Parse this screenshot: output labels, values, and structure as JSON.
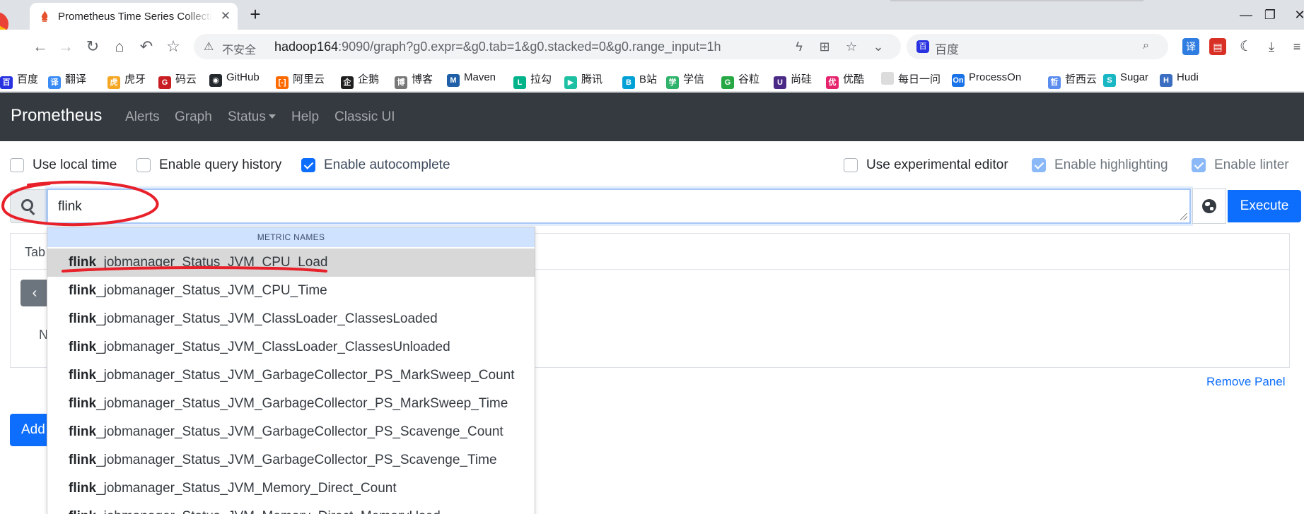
{
  "browser": {
    "tab_title": "Prometheus Time Series Collection and Processing Server",
    "tab_close": "✕",
    "new_tab": "+",
    "window_controls": {
      "minimize": "—",
      "restore": "❐",
      "close": "✕"
    },
    "security_label": "不安全",
    "url_host": "hadoop164",
    "url_rest": ":9090/graph?g0.expr=&g0.tab=1&g0.stacked=0&g0.range_input=1h",
    "search_placeholder": "百度",
    "icons": [
      "back-icon",
      "forward-icon",
      "reload-icon",
      "home-icon",
      "undo-icon",
      "favorite-icon",
      "lightning-icon",
      "translate-icon",
      "star-icon",
      "chevron-down-icon",
      "search-icon",
      "translate-ext-icon",
      "pdf-ext-icon",
      "dark-mode-icon",
      "download-icon",
      "menu-icon"
    ]
  },
  "bookmarks": [
    {
      "label": "百度",
      "icon_color": "#2932e1",
      "glyph": "百"
    },
    {
      "label": "翻译",
      "icon_color": "#3b8cf7",
      "glyph": "译"
    },
    {
      "label": "虎牙",
      "icon_color": "#f5a623",
      "glyph": "虎"
    },
    {
      "label": "码云",
      "icon_color": "#c71d23",
      "glyph": "G"
    },
    {
      "label": "GitHub",
      "icon_color": "#24292e",
      "glyph": "◉"
    },
    {
      "label": "阿里云",
      "icon_color": "#ff6a00",
      "glyph": "[-]"
    },
    {
      "label": "企鹅",
      "icon_color": "#1f1f1f",
      "glyph": "企"
    },
    {
      "label": "博客",
      "icon_color": "#777777",
      "glyph": "博"
    },
    {
      "label": "Maven",
      "icon_color": "#1f5fa8",
      "glyph": "M"
    },
    {
      "label": "拉勾",
      "icon_color": "#00b38a",
      "glyph": "L"
    },
    {
      "label": "腾讯",
      "icon_color": "#1dc0a3",
      "glyph": "▶"
    },
    {
      "label": "B站",
      "icon_color": "#00a1d6",
      "glyph": "B"
    },
    {
      "label": "学信",
      "icon_color": "#2fb36b",
      "glyph": "学"
    },
    {
      "label": "谷粒",
      "icon_color": "#27a844",
      "glyph": "G"
    },
    {
      "label": "尚硅",
      "icon_color": "#4b2a85",
      "glyph": "U"
    },
    {
      "label": "优酷",
      "icon_color": "#e6246e",
      "glyph": "优"
    },
    {
      "label": "每日一问",
      "icon_color": "#dcdcdc",
      "glyph": ""
    },
    {
      "label": "ProcessOn",
      "icon_color": "#1a73e8",
      "glyph": "On"
    },
    {
      "label": "哲西云",
      "icon_color": "#5b8def",
      "glyph": "哲"
    },
    {
      "label": "Sugar",
      "icon_color": "#19b7c4",
      "glyph": "S"
    },
    {
      "label": "Hudi",
      "icon_color": "#3b6ec1",
      "glyph": "H"
    }
  ],
  "navbar": {
    "brand": "Prometheus",
    "links": [
      "Alerts",
      "Graph",
      "Status",
      "Help",
      "Classic UI"
    ]
  },
  "options": {
    "use_local_time": {
      "label": "Use local time",
      "checked": false
    },
    "enable_query_history": {
      "label": "Enable query history",
      "checked": false
    },
    "enable_autocomplete": {
      "label": "Enable autocomplete",
      "checked": true
    },
    "use_experimental_editor": {
      "label": "Use experimental editor",
      "checked": false
    },
    "enable_highlighting": {
      "label": "Enable highlighting",
      "checked": true
    },
    "enable_linter": {
      "label": "Enable linter",
      "checked": true
    }
  },
  "query": {
    "value": "flink",
    "execute_label": "Execute"
  },
  "panel": {
    "tab_label_partial": "Tab",
    "prev_glyph": "‹",
    "body_text_partial": "N",
    "remove_label": "Remove Panel",
    "add_label_partial": "Add"
  },
  "autocomplete": {
    "header": "METRIC NAMES",
    "match": "flink",
    "selected_index": 0,
    "items": [
      "_jobmanager_Status_JVM_CPU_Load",
      "_jobmanager_Status_JVM_CPU_Time",
      "_jobmanager_Status_JVM_ClassLoader_ClassesLoaded",
      "_jobmanager_Status_JVM_ClassLoader_ClassesUnloaded",
      "_jobmanager_Status_JVM_GarbageCollector_PS_MarkSweep_Count",
      "_jobmanager_Status_JVM_GarbageCollector_PS_MarkSweep_Time",
      "_jobmanager_Status_JVM_GarbageCollector_PS_Scavenge_Count",
      "_jobmanager_Status_JVM_GarbageCollector_PS_Scavenge_Time",
      "_jobmanager_Status_JVM_Memory_Direct_Count",
      "_jobmanager_Status_JVM_Memory_Direct_MemoryUsed"
    ]
  },
  "annotation_color": "#e8202a"
}
